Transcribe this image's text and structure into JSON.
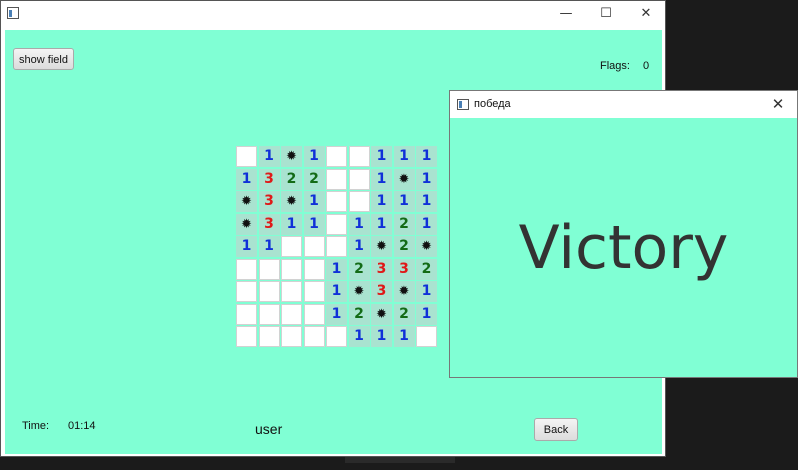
{
  "main_window": {
    "controls": {
      "minimize": "—",
      "maximize": "☐",
      "close": "✕"
    },
    "show_field_label": "show field",
    "flags_label": "Flags:",
    "flags_value": "0",
    "time_label": "Time:",
    "time_value": "01:14",
    "username": "user",
    "back_label": "Back"
  },
  "board": {
    "rows": [
      [
        "",
        "1",
        "*",
        "1",
        "",
        "",
        "1",
        "1",
        "1"
      ],
      [
        "1",
        "3",
        "2",
        "2",
        "",
        "",
        "1",
        "*",
        "1"
      ],
      [
        "*",
        "3",
        "*",
        "1",
        "",
        "",
        "1",
        "1",
        "1"
      ],
      [
        "*",
        "3",
        "1",
        "1",
        "",
        "1",
        "1",
        "2",
        "1"
      ],
      [
        "1",
        "1",
        "",
        "",
        "",
        "1",
        "*",
        "2",
        "*"
      ],
      [
        "",
        "",
        "",
        "",
        "1",
        "2",
        "3",
        "3",
        "2"
      ],
      [
        "",
        "",
        "",
        "",
        "1",
        "*",
        "3",
        "*",
        "1"
      ],
      [
        "",
        "",
        "",
        "",
        "1",
        "2",
        "*",
        "2",
        "1"
      ],
      [
        "",
        "",
        "",
        "",
        "",
        "1",
        "1",
        "1",
        ""
      ]
    ],
    "open": [
      [
        0,
        1,
        1,
        1,
        0,
        0,
        1,
        1,
        1
      ],
      [
        1,
        1,
        1,
        1,
        0,
        0,
        1,
        1,
        1
      ],
      [
        1,
        1,
        1,
        1,
        0,
        0,
        1,
        1,
        1
      ],
      [
        1,
        1,
        1,
        1,
        0,
        1,
        1,
        1,
        1
      ],
      [
        1,
        1,
        0,
        0,
        0,
        1,
        1,
        1,
        1
      ],
      [
        0,
        0,
        0,
        0,
        1,
        1,
        1,
        1,
        1
      ],
      [
        0,
        0,
        0,
        0,
        1,
        1,
        1,
        1,
        1
      ],
      [
        0,
        0,
        0,
        0,
        1,
        1,
        1,
        1,
        1
      ],
      [
        0,
        0,
        0,
        0,
        0,
        1,
        1,
        1,
        0
      ]
    ],
    "mine_glyph": "✹",
    "colors": {
      "1": "#1030d8",
      "2": "#136b16",
      "3": "#e01818",
      "background": "#80ffd4",
      "open_cell": "#a9e3d0"
    }
  },
  "dialog": {
    "title": "победа",
    "close": "✕",
    "message": "Victory"
  }
}
